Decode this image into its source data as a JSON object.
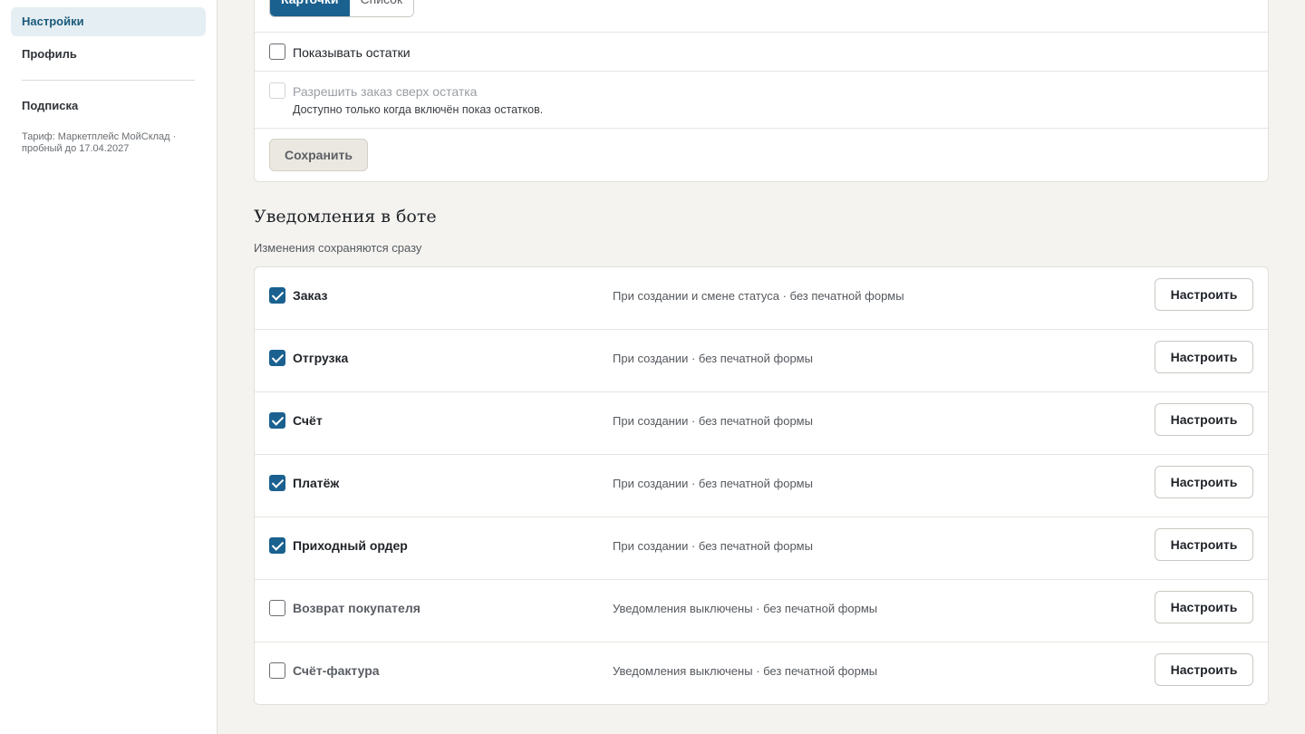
{
  "sidebar": {
    "items": [
      {
        "label": "Настройки",
        "active": true
      },
      {
        "label": "Профиль",
        "active": false
      },
      {
        "label": "Подписка",
        "active": false
      }
    ],
    "tariff": "Тариф: Маркетплейс МойСклад · пробный до 17.04.2027"
  },
  "display": {
    "view_options": [
      "Карточки",
      "Список"
    ],
    "selected_view": "Карточки",
    "show_stock": {
      "label": "Показывать остатки",
      "checked": false
    },
    "allow_overorder": {
      "label": "Разрешить заказ сверх остатка",
      "checked": false,
      "disabled": true,
      "hint": "Доступно только когда включён показ остатков."
    },
    "save_label": "Сохранить"
  },
  "notifications": {
    "title": "Уведомления в боте",
    "subtitle": "Изменения сохраняются сразу",
    "configure_label": "Настроить",
    "rows": [
      {
        "name": "Заказ",
        "enabled": true,
        "desc": "При создании и смене статуса · без печатной формы"
      },
      {
        "name": "Отгрузка",
        "enabled": true,
        "desc": "При создании · без печатной формы"
      },
      {
        "name": "Счёт",
        "enabled": true,
        "desc": "При создании · без печатной формы"
      },
      {
        "name": "Платёж",
        "enabled": true,
        "desc": "При создании · без печатной формы"
      },
      {
        "name": "Приходный ордер",
        "enabled": true,
        "desc": "При создании · без печатной формы"
      },
      {
        "name": "Возврат покупателя",
        "enabled": false,
        "desc": "Уведомления выключены · без печатной формы"
      },
      {
        "name": "Счёт-фактура",
        "enabled": false,
        "desc": "Уведомления выключены · без печатной формы"
      }
    ]
  },
  "colors": {
    "accent": "#1a6190",
    "background": "#f4f3ef",
    "active_nav": "#e4eef3"
  }
}
